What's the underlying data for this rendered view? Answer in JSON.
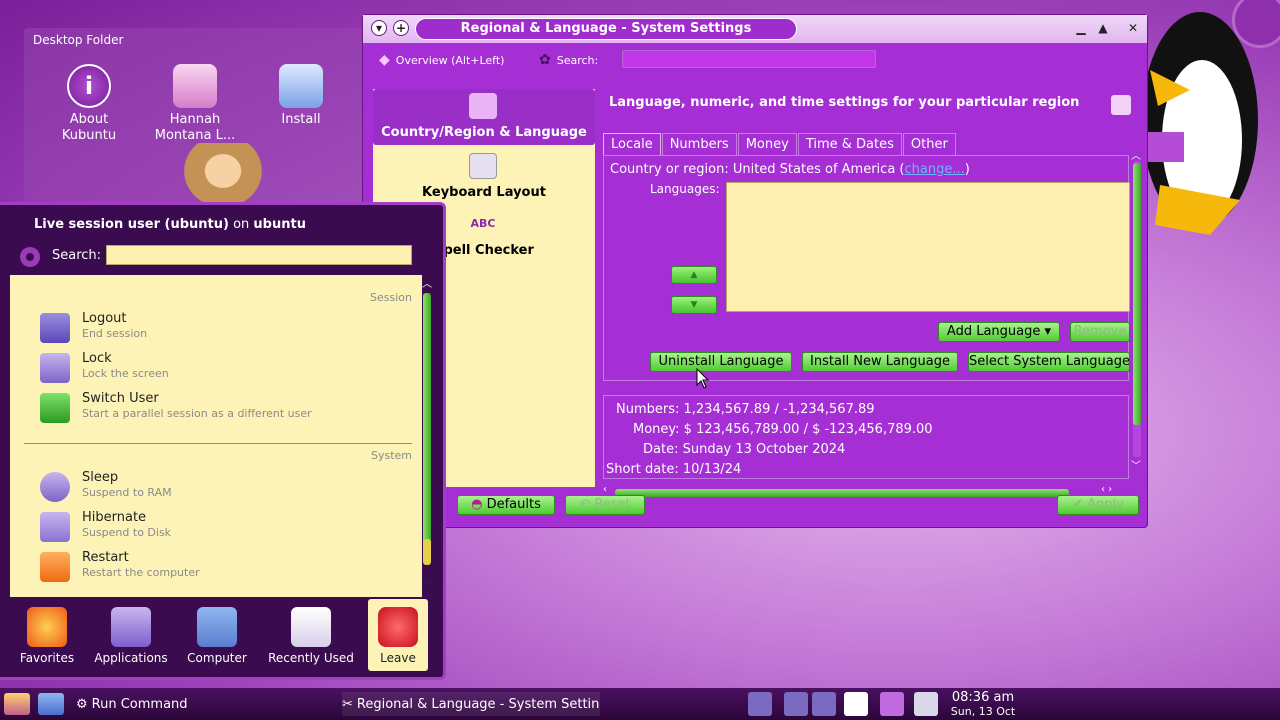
{
  "desktop": {
    "folder_title": "Desktop Folder",
    "icons": [
      {
        "label": "About Kubuntu",
        "icon": "info-icon"
      },
      {
        "label": "Hannah Montana L...",
        "icon": "hannah-montana-icon"
      },
      {
        "label": "Install",
        "icon": "install-icon"
      }
    ]
  },
  "window": {
    "title": "Regional & Language - System Settings",
    "toolbar": {
      "overview_label": "Overview (Alt+Left)",
      "search_label": "Search:",
      "search_value": ""
    },
    "sidebar": [
      {
        "label": "Country/Region & Language",
        "active": true
      },
      {
        "label": "Keyboard Layout",
        "active": false
      },
      {
        "label": "Spell Checker",
        "active": false
      }
    ],
    "heading": "Language, numeric, and time settings for your particular region",
    "tabs": [
      "Locale",
      "Numbers",
      "Money",
      "Time & Dates",
      "Other"
    ],
    "active_tab": "Locale",
    "locale": {
      "country_prefix": "Country or region: United States of America (",
      "change_link": "change...",
      "country_suffix": ")",
      "languages_label": "Languages:",
      "add_language": "Add Language",
      "remove": "Remove",
      "uninstall_language": "Uninstall Language",
      "install_new_language": "Install New Language",
      "select_system_language": "Select System Language"
    },
    "samples": {
      "numbers": "Numbers: 1,234,567.89 / -1,234,567.89",
      "money": "Money: $ 123,456,789.00 / $ -123,456,789.00",
      "date": "Date: Sunday 13 October 2024",
      "short_date": "Short date: 10/13/24"
    },
    "buttons": {
      "defaults": "Defaults",
      "reset": "Reset",
      "apply": "Apply"
    }
  },
  "kickoff": {
    "user": "Live session user (ubuntu)",
    "on": "on",
    "host": "ubuntu",
    "search_label": "Search:",
    "search_value": "",
    "sections": {
      "session": "Session",
      "system": "System"
    },
    "session_items": [
      {
        "name": "Logout",
        "desc": "End session",
        "icon": "logout-icon"
      },
      {
        "name": "Lock",
        "desc": "Lock the screen",
        "icon": "lock-icon"
      },
      {
        "name": "Switch User",
        "desc": "Start a parallel session as a different user",
        "icon": "switch-user-icon"
      }
    ],
    "system_items": [
      {
        "name": "Sleep",
        "desc": "Suspend to RAM",
        "icon": "sleep-icon"
      },
      {
        "name": "Hibernate",
        "desc": "Suspend to Disk",
        "icon": "hibernate-icon"
      },
      {
        "name": "Restart",
        "desc": "Restart the computer",
        "icon": "restart-icon"
      }
    ],
    "tabs": [
      {
        "label": "Favorites",
        "icon": "favorites-star-icon"
      },
      {
        "label": "Applications",
        "icon": "applications-icon"
      },
      {
        "label": "Computer",
        "icon": "computer-icon"
      },
      {
        "label": "Recently Used",
        "icon": "recently-used-icon"
      },
      {
        "label": "Leave",
        "icon": "leave-power-icon"
      }
    ],
    "active_tab": "Leave"
  },
  "taskbar": {
    "run_command": "Run Command",
    "window_task": "Regional & Language - System Settings",
    "clock_time": "08:36 am",
    "clock_date": "Sun, 13 Oct"
  },
  "colors": {
    "accent": "#a52ed4",
    "panel_bg": "#fdf3b6",
    "button_green": "#4fcb35"
  }
}
